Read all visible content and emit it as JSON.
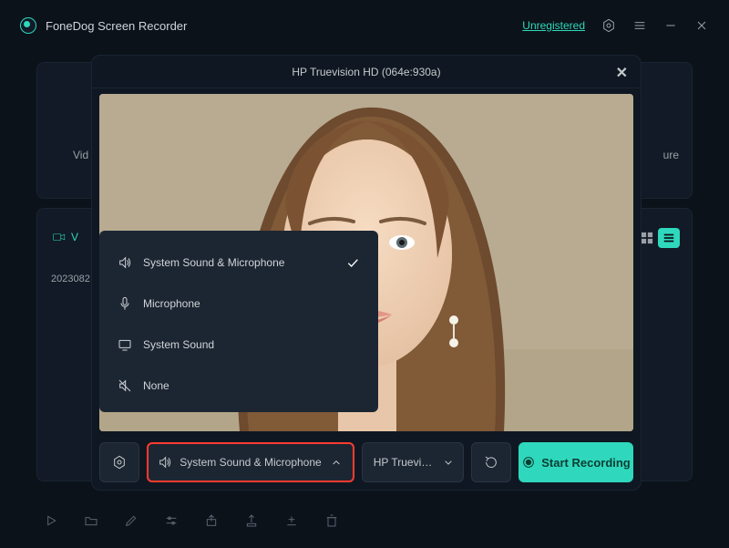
{
  "app": {
    "title": "FoneDog Screen Recorder",
    "status": "Unregistered"
  },
  "bg": {
    "leftText": "Vid",
    "rightText": "ure",
    "tab": "V",
    "row": "2023082"
  },
  "modal": {
    "title": "HP Truevision HD (064e:930a)"
  },
  "audioMenu": {
    "items": [
      {
        "label": "System Sound & Microphone",
        "checked": true
      },
      {
        "label": "Microphone",
        "checked": false
      },
      {
        "label": "System Sound",
        "checked": false
      },
      {
        "label": "None",
        "checked": false
      }
    ]
  },
  "controls": {
    "audio": "System Sound & Microphone",
    "camera": "HP Truevi…",
    "start": "Start Recording"
  }
}
